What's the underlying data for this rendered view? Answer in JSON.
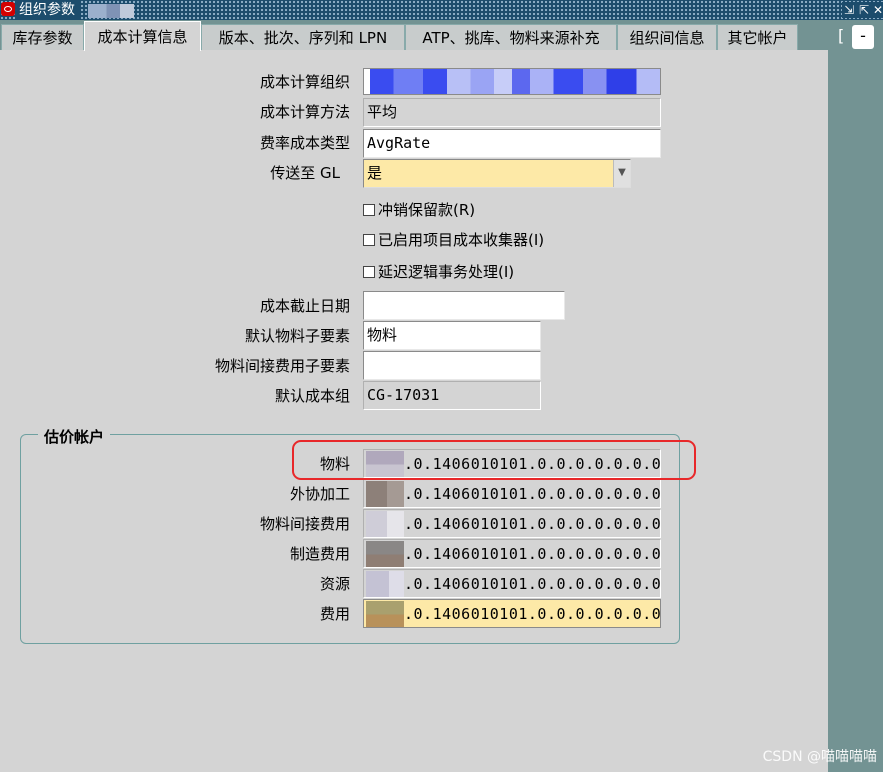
{
  "window": {
    "title": "组织参数"
  },
  "tabs": [
    {
      "label": "库存参数"
    },
    {
      "label": "成本计算信息"
    },
    {
      "label": "版本、批次、序列和 LPN"
    },
    {
      "label": "ATP、挑库、物料来源补充"
    },
    {
      "label": "组织间信息"
    },
    {
      "label": "其它帐户"
    }
  ],
  "tabs_overflow": {
    "bracket": "[",
    "box": "-"
  },
  "form": {
    "cost_org_label": "成本计算组织",
    "cost_method_label": "成本计算方法",
    "cost_method_value": "平均",
    "rate_type_label": "费率成本类型",
    "rate_type_value": "AvgRate",
    "transfer_gl_label": "传送至 GL",
    "transfer_gl_value": "是",
    "chk_reverse": "冲销保留款(R)",
    "chk_project": "已启用项目成本收集器(I)",
    "chk_defer": "延迟逻辑事务处理(I)",
    "cutoff_label": "成本截止日期",
    "cutoff_value": "",
    "material_sub_label": "默认物料子要素",
    "material_sub_value": "物料",
    "overhead_sub_label": "物料间接费用子要素",
    "overhead_sub_value": "",
    "cost_group_label": "默认成本组",
    "cost_group_value": "CG-17031"
  },
  "valuation": {
    "title": "估价帐户",
    "rows": [
      {
        "label": "物料",
        "value": ".0.1406010101.0.0.0.0.0.0.0"
      },
      {
        "label": "外协加工",
        "value": ".0.1406010101.0.0.0.0.0.0.0"
      },
      {
        "label": "物料间接费用",
        "value": ".0.1406010101.0.0.0.0.0.0.0"
      },
      {
        "label": "制造费用",
        "value": ".0.1406010101.0.0.0.0.0.0.0"
      },
      {
        "label": "资源",
        "value": ".0.1406010101.0.0.0.0.0.0.0"
      },
      {
        "label": "费用",
        "value": ".0.1406010101.0.0.0.0.0.0.0"
      }
    ]
  },
  "watermark": "CSDN @喵喵喵喵"
}
